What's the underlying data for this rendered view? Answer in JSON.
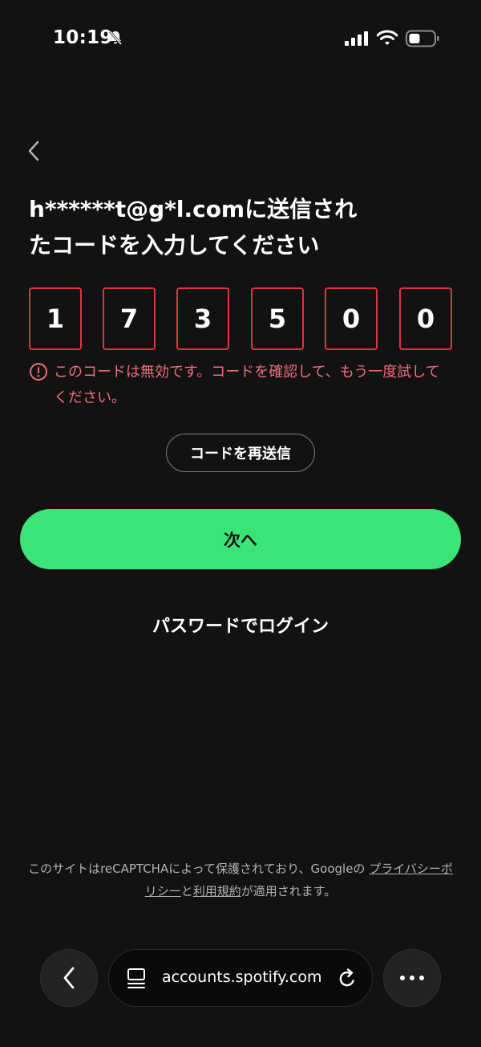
{
  "status_bar": {
    "time": "10:19",
    "icons": [
      "bell-slash-icon",
      "signal-icon",
      "wifi-icon",
      "battery-icon"
    ]
  },
  "header": {
    "back_icon": "chevron-left-icon",
    "title": "h******t@g*l.comに送信されたコードを入力してください"
  },
  "code_inputs": {
    "digits": [
      "1",
      "7",
      "3",
      "5",
      "0",
      "0"
    ],
    "state": "error"
  },
  "error": {
    "icon": "alert-circle-icon",
    "message": "このコードは無効です。コードを確認して、もう一度試してください。"
  },
  "buttons": {
    "resend_label": "コードを再送信",
    "next_label": "次へ",
    "password_login_label": "パスワードでログイン"
  },
  "footer": {
    "recaptcha_prefix": "このサイトはreCAPTCHAによって保護されており、Googleの",
    "privacy_link": "プライバシーポリシー",
    "conjunction": "と",
    "terms_link": "利用規約",
    "recaptcha_suffix": "が適用されます。"
  },
  "browser_bar": {
    "url": "accounts.spotify.com",
    "icons": [
      "chevron-left-icon",
      "tabs-icon",
      "reload-icon",
      "more-icon"
    ]
  },
  "colors": {
    "background": "#121212",
    "accent_green": "#3be477",
    "error_red": "#e0343f",
    "error_text": "#f26c7c"
  }
}
